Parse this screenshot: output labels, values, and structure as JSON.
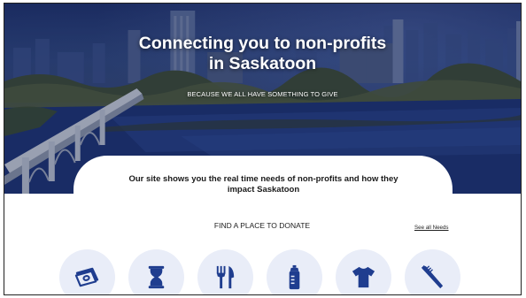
{
  "hero": {
    "title_line1": "Connecting you to non-profits",
    "title_line2": "in Saskatoon",
    "subtitle": "BECAUSE WE ALL HAVE SOMETHING TO GIVE"
  },
  "intro": {
    "line1": "Our site shows you the real time needs of non-profits and how they",
    "line2": "impact Saskatoon"
  },
  "donate": {
    "heading": "FIND A PLACE TO DONATE",
    "see_all": "See all Needs"
  },
  "categories": [
    {
      "icon": "money-icon"
    },
    {
      "icon": "hourglass-icon"
    },
    {
      "icon": "fork-knife-icon"
    },
    {
      "icon": "baby-bottle-icon"
    },
    {
      "icon": "tshirt-icon"
    },
    {
      "icon": "toothbrush-icon"
    }
  ],
  "colors": {
    "icon": "#1f3d8f",
    "icon_background": "#e9edf8",
    "hero_overlay": "#1b2d68"
  }
}
